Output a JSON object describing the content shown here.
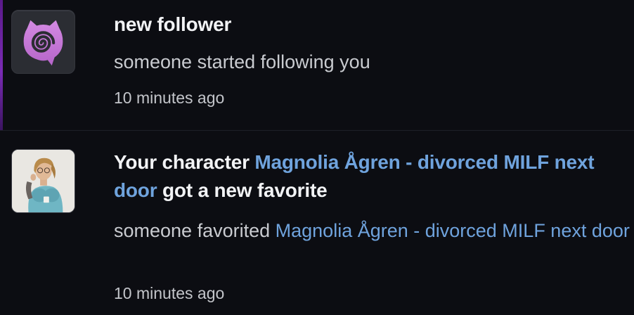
{
  "notifications": [
    {
      "avatar_icon": "spiral-cat-icon",
      "title": "new follower",
      "description": "someone started following you",
      "time": "10 minutes ago"
    },
    {
      "avatar_icon": "character-portrait",
      "title_prefix": "Your character ",
      "title_link": "Magnolia Ågren - divorced MILF next door",
      "title_suffix": " got a new favorite",
      "description_prefix": "someone favorited ",
      "description_link": "Magnolia Ågren - divorced MILF next door",
      "time": "10 minutes ago"
    }
  ],
  "colors": {
    "background": "#0c0d12",
    "link": "#6fa3dd",
    "title": "#f2f3f5",
    "text": "#c9cbd0",
    "icon_purple": "#c47ad6"
  }
}
